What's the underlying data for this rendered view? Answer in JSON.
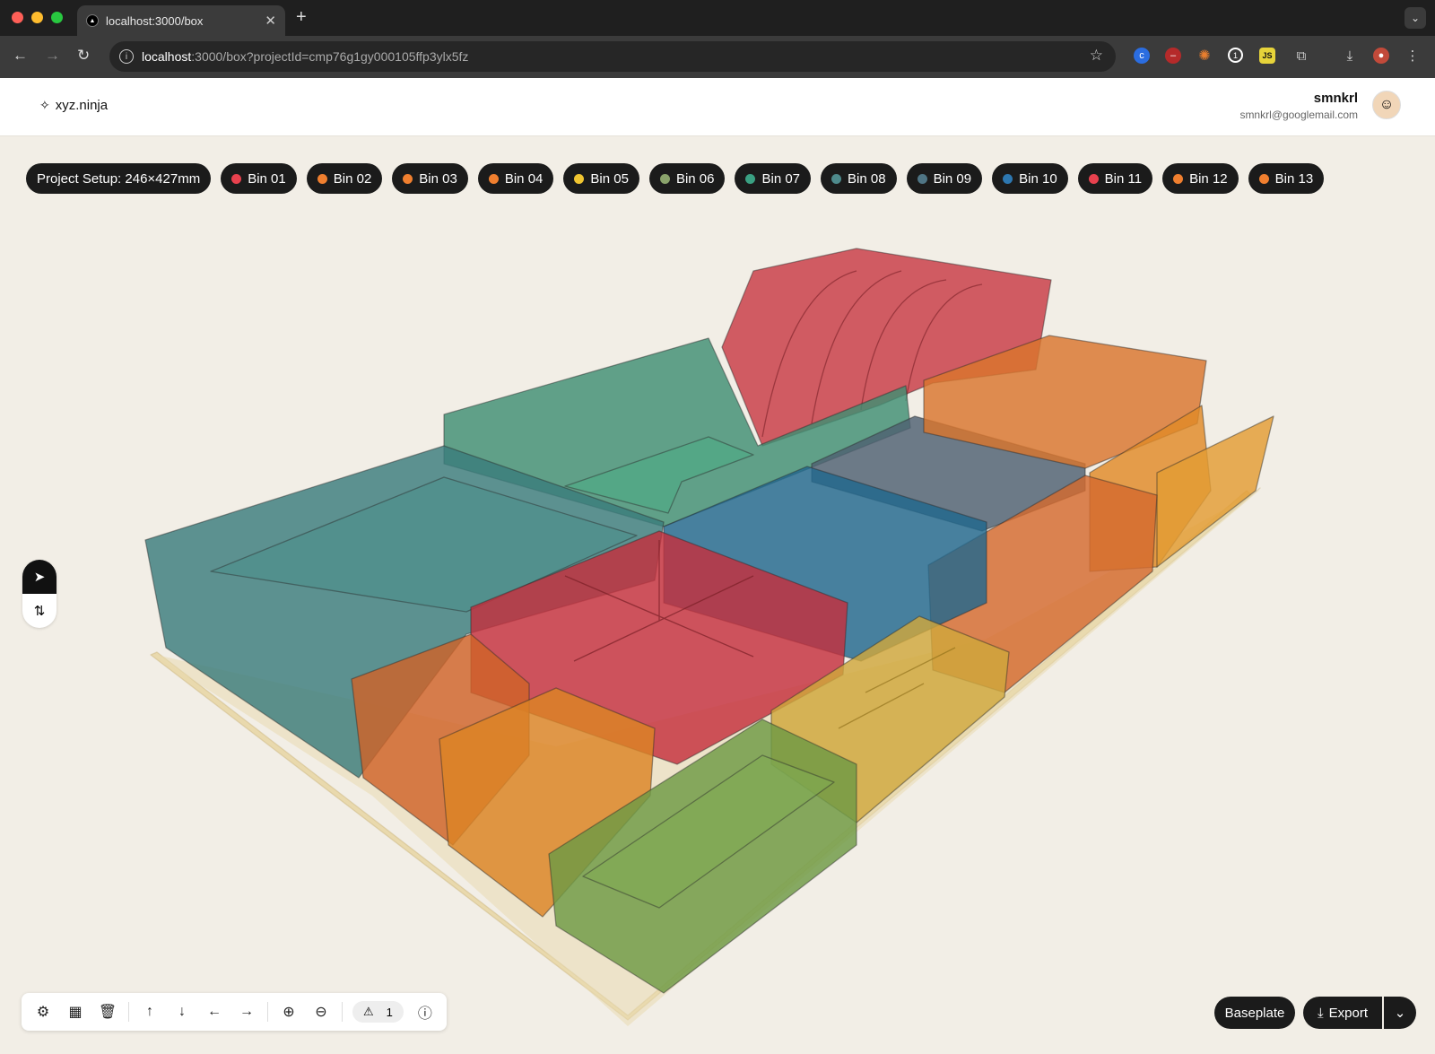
{
  "browser": {
    "tab_title": "localhost:3000/box",
    "url_host": "localhost",
    "url_rest": ":3000/box?projectId=cmp76g1gy000105ffp3ylx5fz"
  },
  "app": {
    "logo": "xyz.ninja",
    "user_name": "smnkrl",
    "user_email": "smnkrl@googlemail.com"
  },
  "chips": [
    {
      "label": "Project Setup: 246×427mm"
    },
    {
      "label": "Bin 01",
      "color": "#e8414e"
    },
    {
      "label": "Bin 02",
      "color": "#f07f2f"
    },
    {
      "label": "Bin 03",
      "color": "#f07f2f"
    },
    {
      "label": "Bin 04",
      "color": "#f07f2f"
    },
    {
      "label": "Bin 05",
      "color": "#f0c531"
    },
    {
      "label": "Bin 06",
      "color": "#8aa36b"
    },
    {
      "label": "Bin 07",
      "color": "#3aa082"
    },
    {
      "label": "Bin 08",
      "color": "#4e8a8c"
    },
    {
      "label": "Bin 09",
      "color": "#4f7585"
    },
    {
      "label": "Bin 10",
      "color": "#2d77b0"
    },
    {
      "label": "Bin 11",
      "color": "#e8414e"
    },
    {
      "label": "Bin 12",
      "color": "#f07f2f"
    },
    {
      "label": "Bin 13",
      "color": "#f07f2f"
    }
  ],
  "toolbar": {
    "warning_count": "1"
  },
  "actions": {
    "baseplate": "Baseplate",
    "export": "Export"
  }
}
